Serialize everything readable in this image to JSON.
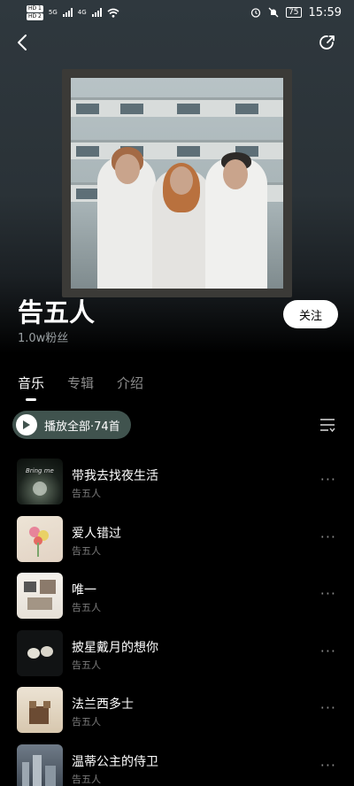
{
  "status_bar": {
    "hd1": "HD 1",
    "hd2": "HD 2",
    "net1": "5G",
    "net2": "4G",
    "battery": "75",
    "time": "15:59"
  },
  "artist": {
    "name": "告五人",
    "fans": "1.0w粉丝",
    "follow_label": "关注"
  },
  "tabs": [
    {
      "label": "音乐",
      "active": true
    },
    {
      "label": "专辑",
      "active": false
    },
    {
      "label": "介绍",
      "active": false
    }
  ],
  "play_all_label": "播放全部·74首",
  "songs": [
    {
      "title": "带我去找夜生活",
      "artist": "告五人",
      "more": "···"
    },
    {
      "title": "爱人错过",
      "artist": "告五人",
      "more": "···"
    },
    {
      "title": "唯一",
      "artist": "告五人",
      "more": "···"
    },
    {
      "title": "披星戴月的想你",
      "artist": "告五人",
      "more": "···"
    },
    {
      "title": "法兰西多士",
      "artist": "告五人",
      "more": "···"
    },
    {
      "title": "温蒂公主的侍卫",
      "artist": "告五人",
      "more": "···"
    }
  ],
  "icons": {
    "back": "back-arrow-icon",
    "share": "share-icon",
    "play": "play-icon",
    "options": "list-options-icon"
  }
}
